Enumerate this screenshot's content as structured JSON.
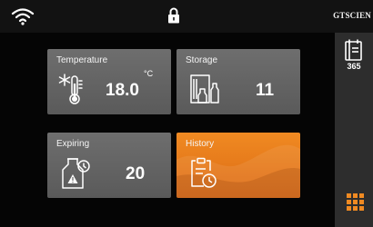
{
  "status_bar": {
    "brand": "GTSCIEN",
    "icons": [
      "wifi-icon",
      "lock-icon"
    ]
  },
  "tiles": {
    "temperature": {
      "title": "Temperature",
      "value": "18.0",
      "unit": "°C",
      "icon": "thermometer-snowflake-icon"
    },
    "storage": {
      "title": "Storage",
      "value": "11",
      "icon": "storage-cabinet-bottles-icon"
    },
    "expiring": {
      "title": "Expiring",
      "value": "20",
      "icon": "bottle-warning-clock-icon"
    },
    "history": {
      "title": "History",
      "icon": "clipboard-clock-icon"
    }
  },
  "right_panel": {
    "days": "365",
    "icons": [
      "calendar-icon",
      "grid-menu-icon"
    ]
  },
  "colors": {
    "tile_gray": "#626262",
    "tile_accent": "#e87a1c",
    "menu_accent": "#f08a22",
    "status_bar": "#121212",
    "side_panel": "#2d2d2d"
  }
}
